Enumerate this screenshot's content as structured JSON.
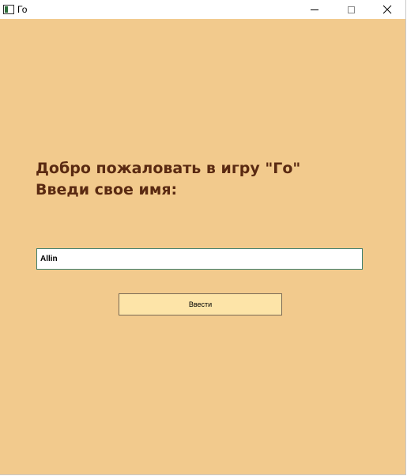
{
  "window": {
    "title": "Го",
    "icon": "app-icon"
  },
  "titlebar_controls": {
    "minimize_icon": "minimize-icon",
    "maximize_icon": "maximize-icon",
    "close_icon": "close-icon"
  },
  "welcome": {
    "line1": "Добро пожаловать в игру \"Го\"",
    "line2": "Введи свое имя:"
  },
  "name_input": {
    "value": "Allin"
  },
  "submit": {
    "label": "Ввести"
  },
  "colors": {
    "background": "#f2ca8d",
    "heading_text": "#5a2a12",
    "button_fill": "#fde4a8",
    "input_border": "#3f7f6e"
  }
}
